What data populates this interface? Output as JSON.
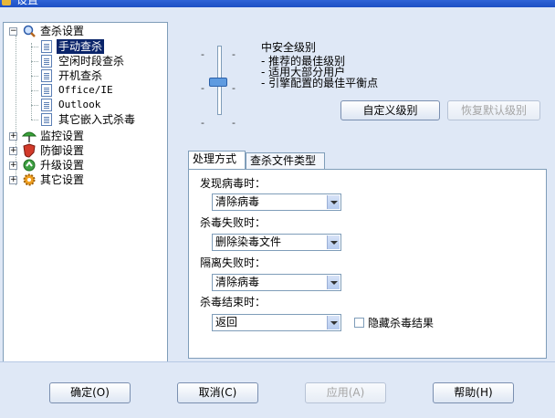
{
  "window": {
    "title": "设置"
  },
  "tree": {
    "root": {
      "label": "查杀设置",
      "icon": "magnifier-icon"
    },
    "children": [
      {
        "label": "手动查杀",
        "selected": true
      },
      {
        "label": "空闲时段查杀"
      },
      {
        "label": "开机查杀"
      },
      {
        "label": "Office/IE"
      },
      {
        "label": "Outlook"
      },
      {
        "label": "其它嵌入式杀毒"
      }
    ],
    "siblings": [
      {
        "label": "监控设置",
        "icon": "monitor-umbrella-icon"
      },
      {
        "label": "防御设置",
        "icon": "shield-icon"
      },
      {
        "label": "升级设置",
        "icon": "update-icon"
      },
      {
        "label": "其它设置",
        "icon": "gear-icon"
      }
    ]
  },
  "level": {
    "title": "中安全级别",
    "desc": [
      "- 推荐的最佳级别",
      "- 适用大部分用户",
      "- 引擎配置的最佳平衡点"
    ],
    "slider_position": 0.5
  },
  "buttons": {
    "custom_level": "自定义级别",
    "restore_default": "恢复默认级别",
    "ok": "确定(O)",
    "cancel": "取消(C)",
    "apply": "应用(A)",
    "help": "帮助(H)"
  },
  "tabs": [
    {
      "label": "处理方式",
      "active": true
    },
    {
      "label": "查杀文件类型"
    }
  ],
  "handling": {
    "found_label": "发现病毒时：",
    "found_value": "清除病毒",
    "kill_fail_label": "杀毒失败时：",
    "kill_fail_value": "删除染毒文件",
    "quarantine_fail_label": "隔离失败时：",
    "quarantine_fail_value": "清除病毒",
    "kill_end_label": "杀毒结束时：",
    "kill_end_value": "返回",
    "hide_result_label": "隐藏杀毒结果",
    "hide_result_checked": false
  }
}
